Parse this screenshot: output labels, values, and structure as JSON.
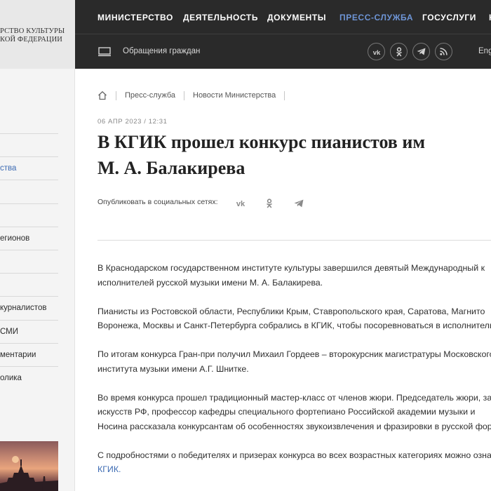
{
  "logo": {
    "line1": "РСТВО КУЛЬТУРЫ",
    "line2": "КОЙ ФЕДЕРАЦИИ"
  },
  "sidebar": {
    "items": [
      {
        "label": ""
      },
      {
        "label": "ства"
      },
      {
        "label": ""
      },
      {
        "label": ""
      },
      {
        "label": "егионов"
      },
      {
        "label": ""
      },
      {
        "label": ""
      },
      {
        "label": "курналистов"
      },
      {
        "label": " СМИ"
      },
      {
        "label": "ментарии"
      },
      {
        "label": "олика"
      }
    ],
    "active_index": 1
  },
  "nav": {
    "items": [
      {
        "label": "МИНИСТЕРСТВО"
      },
      {
        "label": "ДЕЯТЕЛЬНОСТЬ"
      },
      {
        "label": "ДОКУМЕНТЫ"
      },
      {
        "label": "ПРЕСС-СЛУЖБА"
      },
      {
        "label": "ГОСУСЛУГИ"
      },
      {
        "label": "К"
      }
    ],
    "active_index": 3
  },
  "subnav": {
    "appeals": "Обращения граждан",
    "lang": "Eng",
    "social_icons": [
      "vk-icon",
      "odnoklassniki-icon",
      "telegram-icon",
      "rss-icon"
    ]
  },
  "breadcrumb": {
    "items": [
      {
        "label": "Пресс-служба"
      },
      {
        "label": "Новости Министерства"
      }
    ]
  },
  "article": {
    "date": "06 АПР 2023 / 12:31",
    "title_line1": "В КГИК прошел конкурс пианистов им",
    "title_line2": "М. А. Балакирева",
    "share_label": "Опубликовать в социальных сетях:",
    "paragraphs": [
      {
        "line1": "В Краснодарском государственном институте культуры завершился девятый Международный к",
        "line2": "исполнителей русской музыки имени М. А. Балакирева."
      },
      {
        "line1": "Пианисты из Ростовской области, Республики Крым, Ставропольского края, Саратова, Магнито",
        "line2": "Воронежа, Москвы и Санкт-Петербурга собрались в КГИК, чтобы посоревноваться в исполнительск"
      },
      {
        "line1": "По итогам конкурса Гран-при получил Михаил Гордеев – второкурсник магистратуры Московского",
        "line2": "института музыки имени А.Г. Шнитке."
      },
      {
        "line1": "Во время конкурса прошел традиционный мастер-класс от членов жюри. Председатель жюри, зас",
        "line2": "искусств РФ, профессор кафедры специального фортепиано Российской академии музыки и",
        "line3": "Носина рассказала конкурсантам об особенностях звукоизвлечения и фразировки в русской форт"
      },
      {
        "line1": "С подробностями о победителях и призерах конкурса во всех возрастных категориях можно озна",
        "link": "КГИК."
      }
    ]
  },
  "colors": {
    "topbar_bg": "#2a2a2a",
    "accent": "#3d6bb3",
    "nav_active": "#6e95d6"
  }
}
